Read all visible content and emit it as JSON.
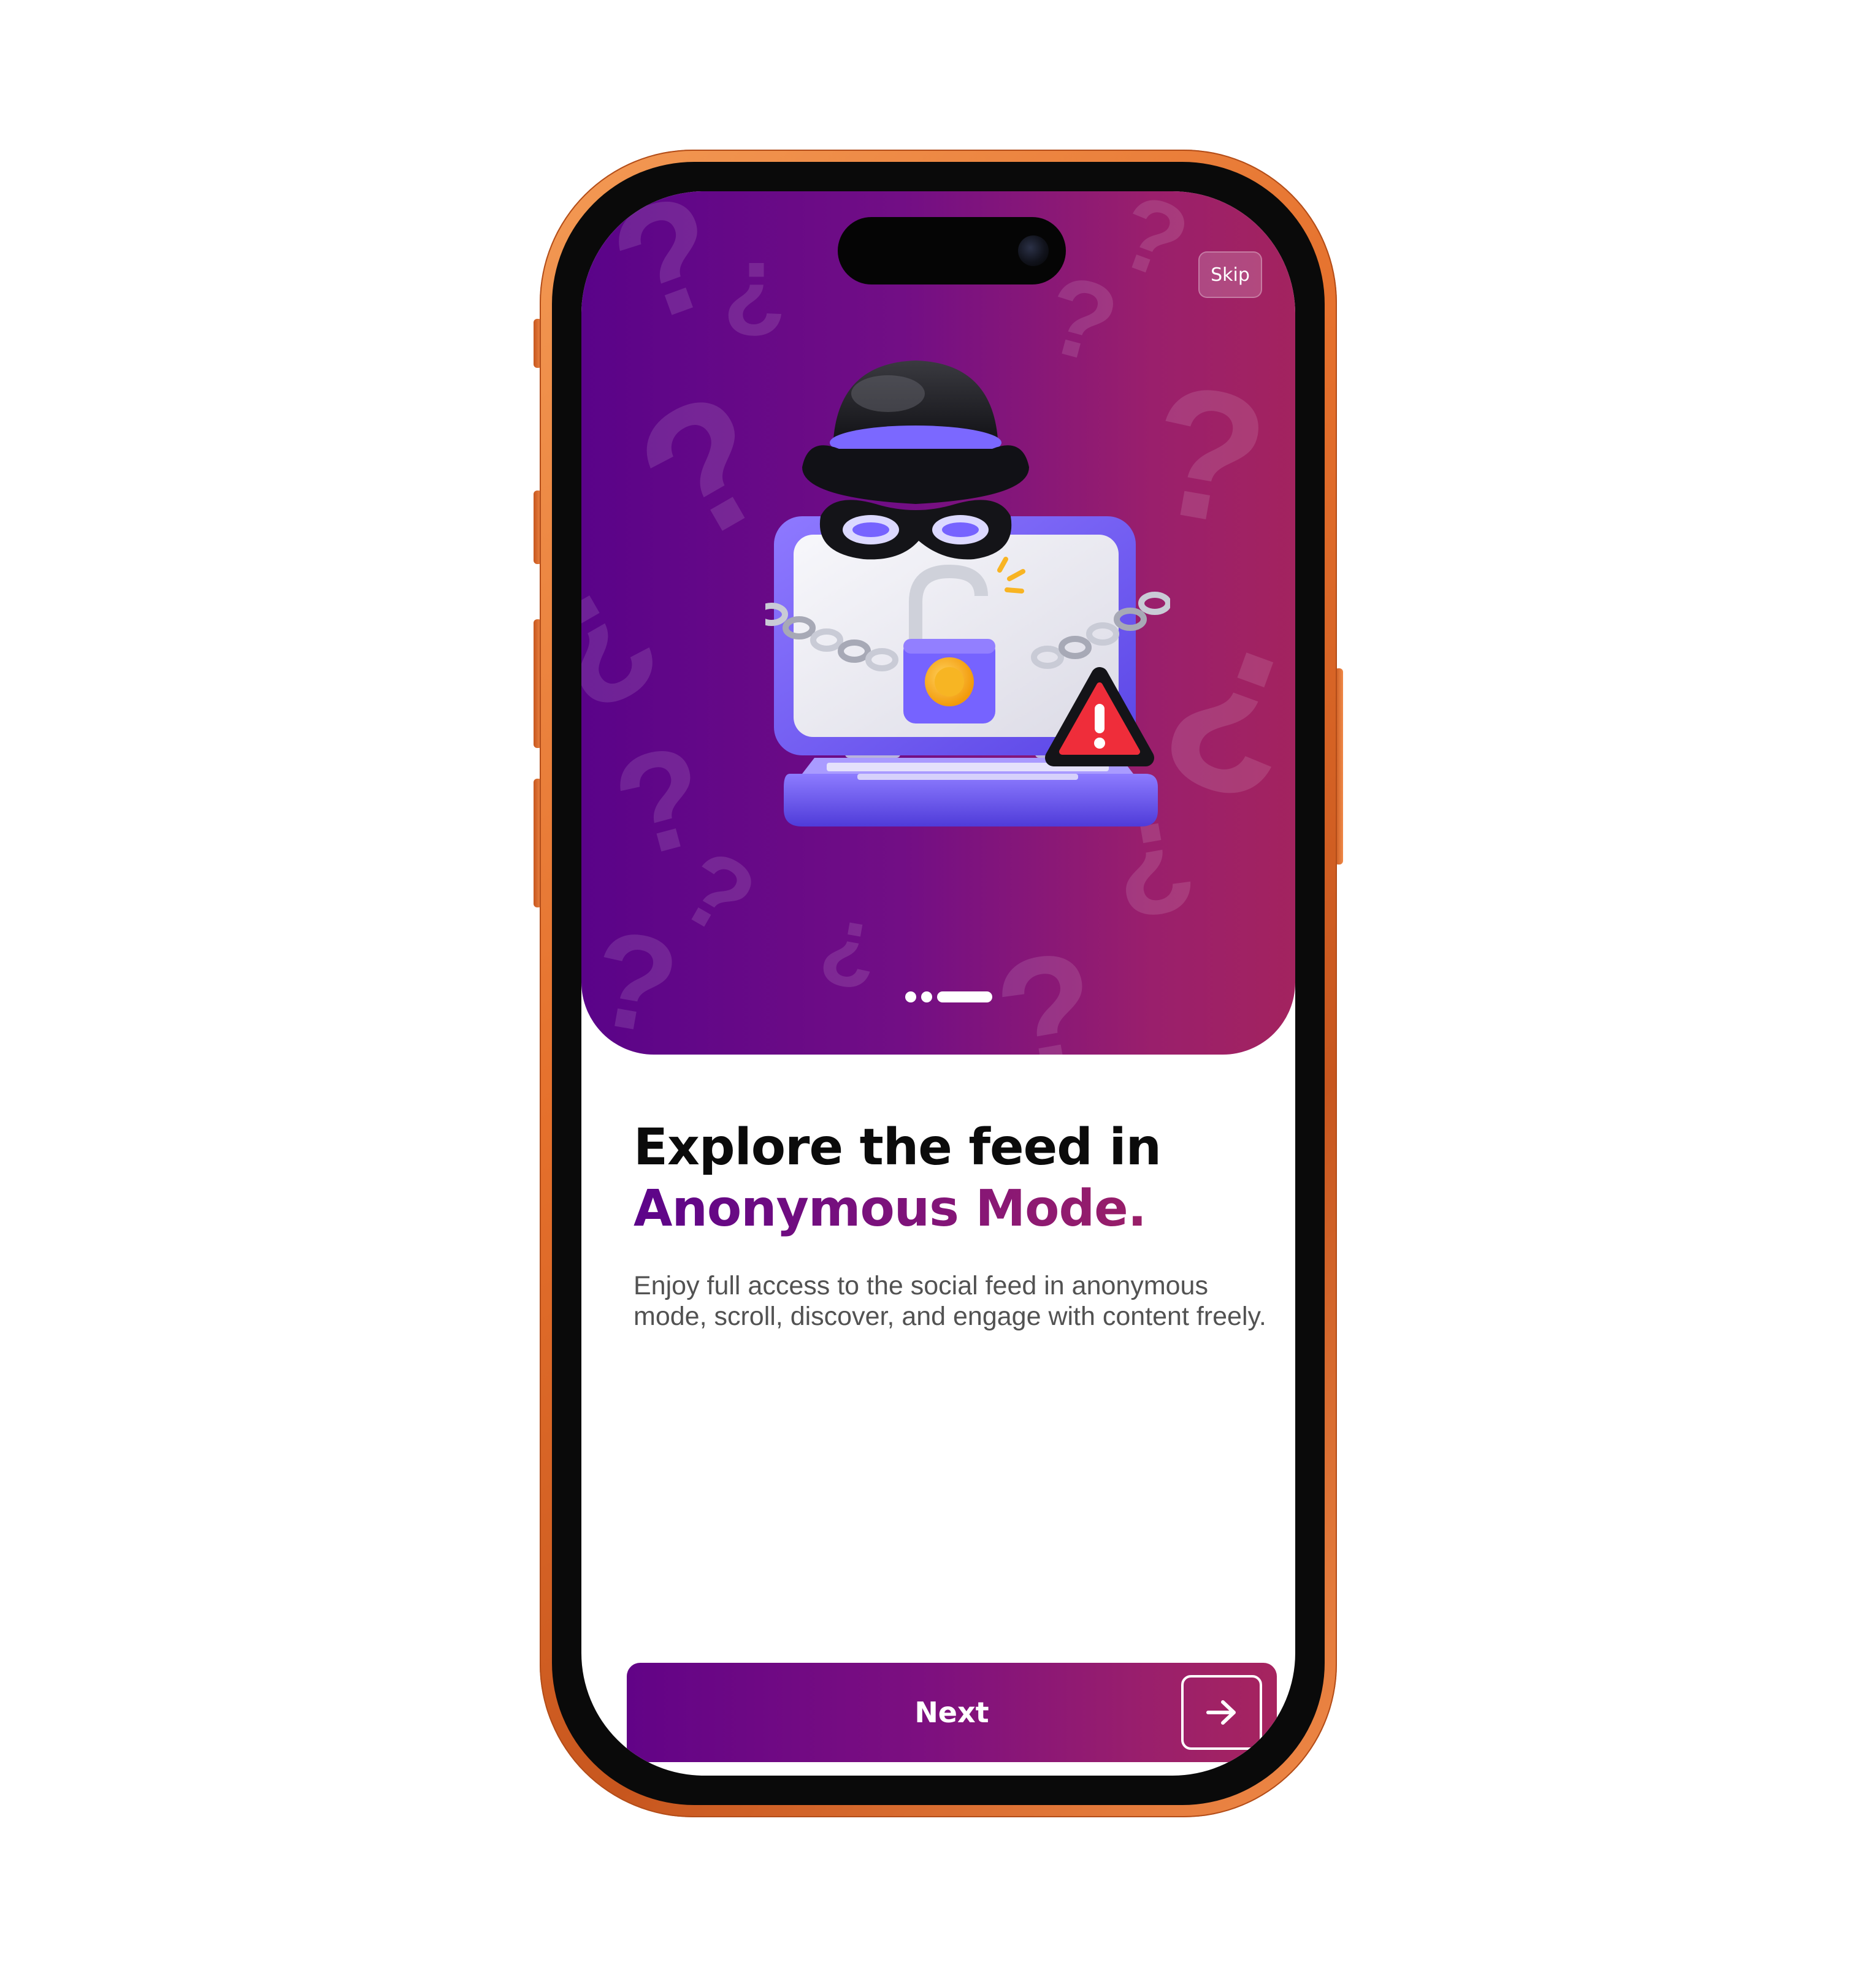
{
  "onboarding": {
    "skip_label": "Skip",
    "headline_line1": "Explore the feed in",
    "headline_line2": "Anonymous Mode.",
    "description": "Enjoy full access to the social feed in anonymous mode, scroll, discover, and engage with content freely.",
    "next_label": "Next",
    "pagination": {
      "total": 3,
      "current": 3
    }
  },
  "icons": {
    "illustration": "anonymous-hacker-laptop-icon",
    "next_arrow": "arrow-right-icon",
    "warning": "warning-icon",
    "padlock": "padlock-icon"
  },
  "colors": {
    "gradient_start": "#5a0389",
    "gradient_end": "#a3235f",
    "headline_dark": "#0b0b0b",
    "description_gray": "#525252",
    "frame_orange": "#e5702c"
  }
}
